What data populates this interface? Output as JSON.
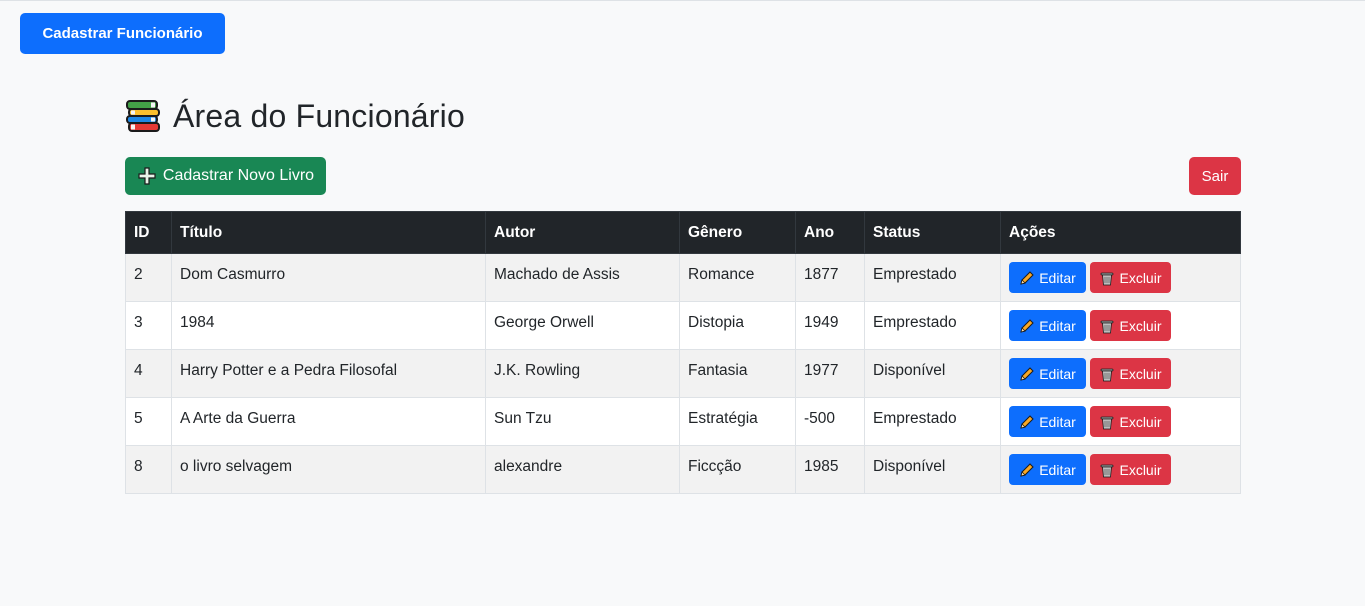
{
  "top_button": {
    "label": "Cadastrar Funcionário"
  },
  "header": {
    "title": "Área do Funcionário",
    "icon": "books-icon"
  },
  "toolbar": {
    "add_label": "Cadastrar Novo Livro",
    "add_icon": "plus-icon",
    "exit_label": "Sair"
  },
  "table": {
    "headers": [
      "ID",
      "Título",
      "Autor",
      "Gênero",
      "Ano",
      "Status",
      "Ações"
    ],
    "rows": [
      {
        "id": "2",
        "titulo": "Dom Casmurro",
        "autor": "Machado de Assis",
        "genero": "Romance",
        "ano": "1877",
        "status": "Emprestado"
      },
      {
        "id": "3",
        "titulo": "1984",
        "autor": "George Orwell",
        "genero": "Distopia",
        "ano": "1949",
        "status": "Emprestado"
      },
      {
        "id": "4",
        "titulo": "Harry Potter e a Pedra Filosofal",
        "autor": "J.K. Rowling",
        "genero": "Fantasia",
        "ano": "1977",
        "status": "Disponível"
      },
      {
        "id": "5",
        "titulo": "A Arte da Guerra",
        "autor": "Sun Tzu",
        "genero": "Estratégia",
        "ano": "-500",
        "status": "Emprestado"
      },
      {
        "id": "8",
        "titulo": "o livro selvagem",
        "autor": "alexandre",
        "genero": "Ficcção",
        "ano": "1985",
        "status": "Disponível"
      }
    ],
    "edit_label": "Editar",
    "delete_label": "Excluir"
  },
  "colors": {
    "primary": "#0d6efd",
    "success": "#198754",
    "danger": "#dc3545",
    "dark": "#212529",
    "background": "#f8f9fa"
  }
}
